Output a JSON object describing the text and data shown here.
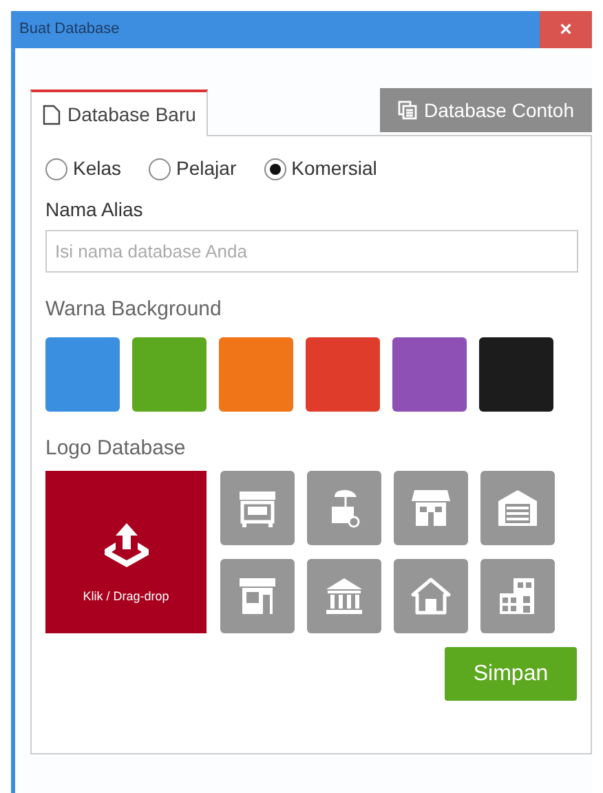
{
  "window": {
    "title": "Buat Database",
    "close": "×"
  },
  "tabs": [
    {
      "label": "Database Baru",
      "kind": "new",
      "selected": true
    },
    {
      "label": "Database Contoh",
      "kind": "sample",
      "selected": false
    }
  ],
  "types": [
    {
      "label": "Kelas",
      "selected": false
    },
    {
      "label": "Pelajar",
      "selected": false
    },
    {
      "label": "Komersial",
      "selected": true
    }
  ],
  "alias": {
    "label": "Nama Alias",
    "placeholder": "Isi nama database Anda"
  },
  "background": {
    "label": "Warna Background",
    "colors": [
      {
        "color": "#3b8fe0"
      },
      {
        "color": "#5ca81e"
      },
      {
        "color": "#f07418"
      },
      {
        "color": "#e03c2c"
      },
      {
        "color": "#8e50b4"
      },
      {
        "color": "#1c1c1c"
      }
    ]
  },
  "logo": {
    "label": "Logo Database",
    "upload": "Klik / Drag-drop",
    "icons": [
      {
        "kind": "kiosk"
      },
      {
        "kind": "cart"
      },
      {
        "kind": "shop"
      },
      {
        "kind": "garage"
      },
      {
        "kind": "store"
      },
      {
        "kind": "bank"
      },
      {
        "kind": "house"
      },
      {
        "kind": "buildings"
      }
    ]
  },
  "save_button": "Simpan"
}
